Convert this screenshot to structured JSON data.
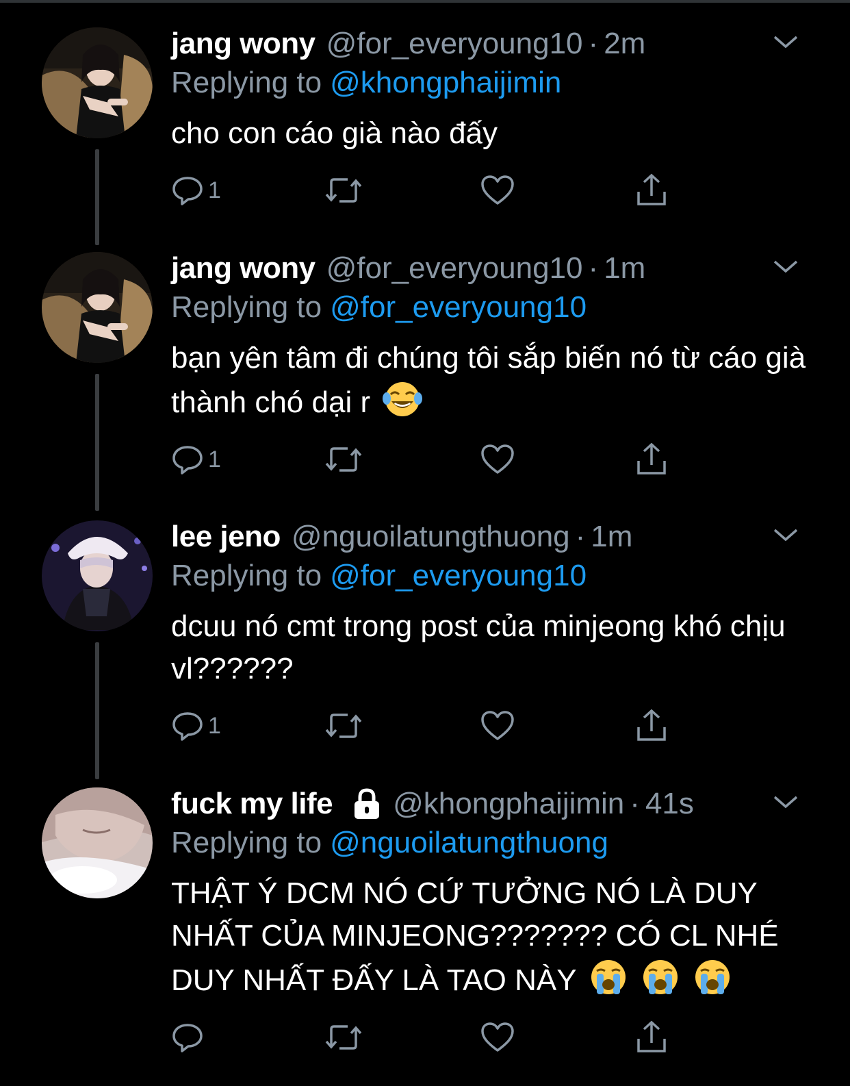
{
  "tweets": [
    {
      "display_name": "jang wony",
      "handle": "@for_everyoung10",
      "separator": "·",
      "time": "2m",
      "replying_label": "Replying to",
      "replying_to": "@khongphaijimin",
      "text": "cho con cáo già nào đấy",
      "reply_count": "1",
      "avatar": "avatar-woman-car",
      "locked": false,
      "emoji": []
    },
    {
      "display_name": "jang wony",
      "handle": "@for_everyoung10",
      "separator": "·",
      "time": "1m",
      "replying_label": "Replying to",
      "replying_to": "@for_everyoung10",
      "text": "bạn yên tâm đi chúng tôi sắp biến nó từ cáo già thành chó dại r",
      "reply_count": "1",
      "avatar": "avatar-woman-car",
      "locked": false,
      "emoji": [
        "laughing-tears-emoji"
      ]
    },
    {
      "display_name": "lee jeno",
      "handle": "@nguoilatungthuong",
      "separator": "·",
      "time": "1m",
      "replying_label": "Replying to",
      "replying_to": "@for_everyoung10",
      "text": "dcuu nó cmt trong post của minjeong khó chịu vl??????",
      "reply_count": "1",
      "avatar": "avatar-man-fur-hat",
      "locked": false,
      "emoji": []
    },
    {
      "display_name": "fuck my life",
      "handle": "@khongphaijimin",
      "separator": "·",
      "time": "41s",
      "replying_label": "Replying to",
      "replying_to": "@nguoilatungthuong",
      "text": "THẬT Ý DCM NÓ CỨ TƯỞNG NÓ LÀ DUY NHẤT CỦA MINJEONG??????? CÓ CL NHÉ DUY NHẤT ĐẤY LÀ TAO NÀY",
      "reply_count": "",
      "avatar": "avatar-sleeping-face",
      "locked": true,
      "emoji": [
        "crying-emoji",
        "crying-emoji",
        "crying-emoji"
      ]
    }
  ],
  "icons": {
    "reply": "reply-bubble-icon",
    "retweet": "retweet-icon",
    "like": "heart-icon",
    "share": "share-icon",
    "more": "chevron-down-icon",
    "lock": "lock-icon"
  },
  "colors": {
    "background": "#000000",
    "text": "#ffffff",
    "muted": "#8b98a5",
    "link": "#1d9bf0",
    "thread_line": "#3a3d40"
  }
}
